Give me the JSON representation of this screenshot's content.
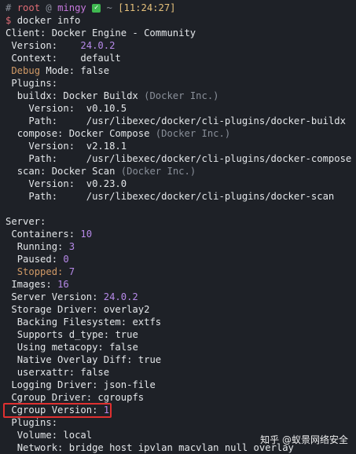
{
  "prompt": {
    "hash": "#",
    "user": "root",
    "at": "@",
    "host": "mingy",
    "check": "✓",
    "tilde": "~",
    "time": "[11:24:27]",
    "dollar": "$",
    "command": "docker info"
  },
  "client": {
    "header": "Client: Docker Engine - Community",
    "version_key": "Version:",
    "version_val": "24.0.2",
    "context_key": "Context:",
    "context_val": "default",
    "debug_key": "Debug",
    "debug_rest": "Mode:",
    "debug_val": "false",
    "plugins_key": "Plugins:",
    "buildx": "buildx: Docker Buildx",
    "buildx_vendor": "(Docker Inc.)",
    "buildx_version": "Version:  v0.10.5",
    "buildx_path": "Path:     /usr/libexec/docker/cli-plugins/docker-buildx",
    "compose": "compose: Docker Compose",
    "compose_vendor": "(Docker Inc.)",
    "compose_version": "Version:  v2.18.1",
    "compose_path": "Path:     /usr/libexec/docker/cli-plugins/docker-compose",
    "scan": "scan: Docker Scan",
    "scan_vendor": "(Docker Inc.)",
    "scan_version": "Version:  v0.23.0",
    "scan_path": "Path:     /usr/libexec/docker/cli-plugins/docker-scan"
  },
  "server": {
    "header": "Server:",
    "containers_key": "Containers:",
    "containers_val": "10",
    "running_key": "Running:",
    "running_val": "3",
    "paused_key": "Paused:",
    "paused_val": "0",
    "stopped_key": "Stopped:",
    "stopped_val": "7",
    "images_key": "Images:",
    "images_val": "16",
    "server_version_key": "Server Version:",
    "server_version_val": "24.0.2",
    "storage_key": "Storage Driver:",
    "storage_val": "overlay2",
    "backing_key": "Backing Filesystem:",
    "backing_val": "extfs",
    "dtype_key": "Supports d_type:",
    "dtype_val": "true",
    "metacopy_key": "Using metacopy:",
    "metacopy_val": "false",
    "overlaydiff_key": "Native Overlay Diff:",
    "overlaydiff_val": "true",
    "userxattr_key": "userxattr:",
    "userxattr_val": "false",
    "logging_key": "Logging Driver:",
    "logging_val": "json-file",
    "cgroup_driver_key": "Cgroup Driver:",
    "cgroup_driver_val": "cgroupfs",
    "cgroup_version_key": "Cgroup Version:",
    "cgroup_version_val": "1",
    "plugins_key": "Plugins:",
    "volume_key": "Volume:",
    "volume_val": "local",
    "network_key": "Network:",
    "network_val": "bridge host ipvlan macvlan null overlay"
  },
  "watermark": "知乎 @蚁景网络安全",
  "colors": {
    "background": "#1e2127",
    "highlight_box": "#e03030",
    "number": "#b689e8"
  }
}
